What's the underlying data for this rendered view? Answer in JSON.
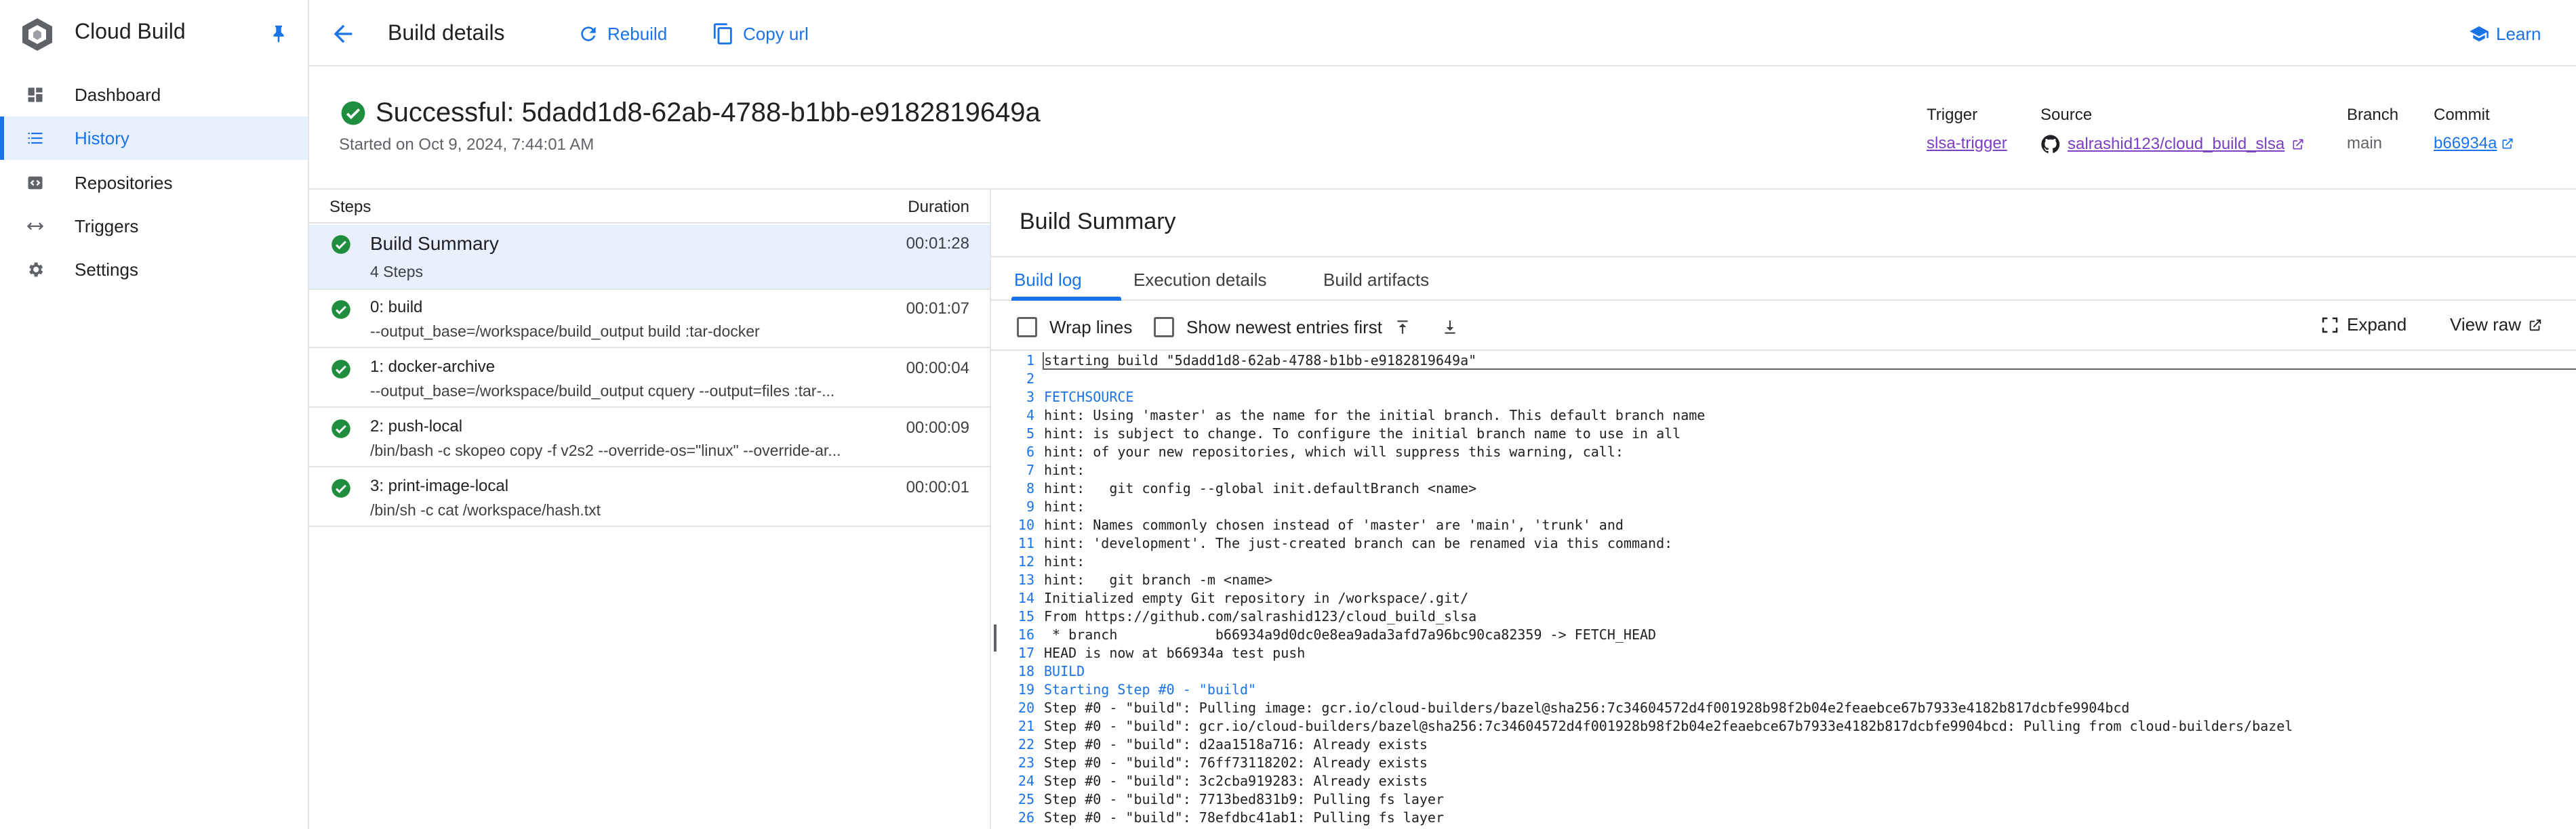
{
  "sidebar": {
    "title": "Cloud Build",
    "items": [
      {
        "label": "Dashboard",
        "icon": "dashboard-icon"
      },
      {
        "label": "History",
        "icon": "list-icon",
        "active": true
      },
      {
        "label": "Repositories",
        "icon": "repository-icon"
      },
      {
        "label": "Triggers",
        "icon": "trigger-arrows-icon"
      },
      {
        "label": "Settings",
        "icon": "gear-icon"
      }
    ]
  },
  "toolbar": {
    "title": "Build details",
    "rebuild_label": "Rebuild",
    "copy_url_label": "Copy url",
    "learn_label": "Learn"
  },
  "build": {
    "status_title": "Successful: 5dadd1d8-62ab-4788-b1bb-e9182819649a",
    "started_on": "Started on Oct 9, 2024, 7:44:01 AM",
    "trigger_label": "Trigger",
    "trigger_value": "slsa-trigger",
    "source_label": "Source",
    "source_value": "salrashid123/cloud_build_slsa",
    "branch_label": "Branch",
    "branch_value": "main",
    "commit_label": "Commit",
    "commit_value": "b66934a"
  },
  "steps": {
    "header_label": "Steps",
    "header_duration": "Duration",
    "rows": [
      {
        "title": "Build Summary",
        "sub": "4 Steps",
        "duration": "00:01:28"
      },
      {
        "title": "0: build",
        "sub": "--output_base=/workspace/build_output build :tar-docker",
        "duration": "00:01:07"
      },
      {
        "title": "1: docker-archive",
        "sub": "--output_base=/workspace/build_output cquery --output=files :tar-...",
        "duration": "00:00:04"
      },
      {
        "title": "2: push-local",
        "sub": "/bin/bash -c skopeo copy -f v2s2 --override-os=\"linux\" --override-ar...",
        "duration": "00:00:09"
      },
      {
        "title": "3: print-image-local",
        "sub": "/bin/sh -c cat /workspace/hash.txt",
        "duration": "00:00:01"
      }
    ]
  },
  "detail": {
    "title": "Build Summary",
    "tabs": [
      "Build log",
      "Execution details",
      "Build artifacts"
    ],
    "wrap_lines": "Wrap lines",
    "show_newest": "Show newest entries first",
    "expand": "Expand",
    "view_raw": "View raw"
  },
  "log": [
    {
      "n": "1",
      "t": "starting build \"5dadd1d8-62ab-4788-b1bb-e9182819649a\""
    },
    {
      "n": "2",
      "t": ""
    },
    {
      "n": "3",
      "t": "FETCHSOURCE"
    },
    {
      "n": "4",
      "t": "hint: Using 'master' as the name for the initial branch. This default branch name"
    },
    {
      "n": "5",
      "t": "hint: is subject to change. To configure the initial branch name to use in all"
    },
    {
      "n": "6",
      "t": "hint: of your new repositories, which will suppress this warning, call:"
    },
    {
      "n": "7",
      "t": "hint:"
    },
    {
      "n": "8",
      "t": "hint:   git config --global init.defaultBranch <name>"
    },
    {
      "n": "9",
      "t": "hint:"
    },
    {
      "n": "10",
      "t": "hint: Names commonly chosen instead of 'master' are 'main', 'trunk' and"
    },
    {
      "n": "11",
      "t": "hint: 'development'. The just-created branch can be renamed via this command:"
    },
    {
      "n": "12",
      "t": "hint:"
    },
    {
      "n": "13",
      "t": "hint:   git branch -m <name>"
    },
    {
      "n": "14",
      "t": "Initialized empty Git repository in /workspace/.git/"
    },
    {
      "n": "15",
      "t": "From https://github.com/salrashid123/cloud_build_slsa"
    },
    {
      "n": "16",
      "t": " * branch            b66934a9d0dc0e8ea9ada3afd7a96bc90ca82359 -> FETCH_HEAD"
    },
    {
      "n": "17",
      "t": "HEAD is now at b66934a test push"
    },
    {
      "n": "18",
      "t": "BUILD"
    },
    {
      "n": "19",
      "t": "Starting Step #0 - \"build\""
    },
    {
      "n": "20",
      "t": "Step #0 - \"build\": Pulling image: gcr.io/cloud-builders/bazel@sha256:7c34604572d4f001928b98f2b04e2feaebce67b7933e4182b817dcbfe9904bcd"
    },
    {
      "n": "21",
      "t": "Step #0 - \"build\": gcr.io/cloud-builders/bazel@sha256:7c34604572d4f001928b98f2b04e2feaebce67b7933e4182b817dcbfe9904bcd: Pulling from cloud-builders/bazel"
    },
    {
      "n": "22",
      "t": "Step #0 - \"build\": d2aa1518a716: Already exists"
    },
    {
      "n": "23",
      "t": "Step #0 - \"build\": 76ff73118202: Already exists"
    },
    {
      "n": "24",
      "t": "Step #0 - \"build\": 3c2cba919283: Already exists"
    },
    {
      "n": "25",
      "t": "Step #0 - \"build\": 7713bed831b9: Pulling fs layer"
    },
    {
      "n": "26",
      "t": "Step #0 - \"build\": 78efdbc41ab1: Pulling fs layer"
    }
  ],
  "colors": {
    "accent": "#1a73e8",
    "success": "#1e8e3e",
    "link_visited": "#7b3fc4",
    "selected_bg": "#e8f0fe"
  }
}
